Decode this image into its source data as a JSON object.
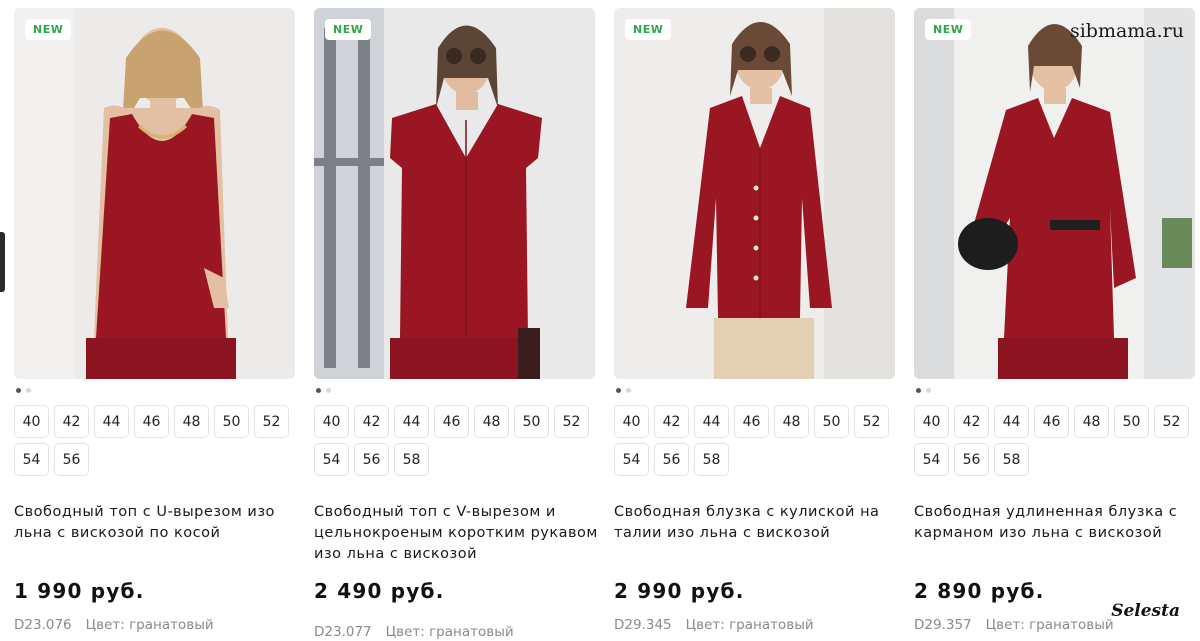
{
  "badge_label": "NEW",
  "watermarks": {
    "top": "sibmama.ru",
    "bottom": "Selesta"
  },
  "products": [
    {
      "badge": "NEW",
      "title": "Свободный топ с U-вырезом изо льна с вискозой по косой",
      "price": "1 990 руб.",
      "code": "D23.076",
      "color": "Цвет: гранатовый",
      "sizes_row1": [
        "40",
        "42",
        "44",
        "46",
        "48",
        "50",
        "52"
      ],
      "sizes_row2": [
        "54",
        "56"
      ],
      "garment": "u-neck-tank-top"
    },
    {
      "badge": "NEW",
      "title": "Свободный топ с V-вырезом и цельнокроеным коротким рукавом изо льна с вискозой",
      "price": "2 490 руб.",
      "code": "D23.077",
      "color": "Цвет: гранатовый",
      "sizes_row1": [
        "40",
        "42",
        "44",
        "46",
        "48",
        "50",
        "52"
      ],
      "sizes_row2": [
        "54",
        "56",
        "58"
      ],
      "garment": "v-neck-top"
    },
    {
      "badge": "NEW",
      "title": "Свободная блузка с кулиской на талии изо льна с вискозой",
      "price": "2 990 руб.",
      "code": "D29.345",
      "color": "Цвет: гранатовый",
      "sizes_row1": [
        "40",
        "42",
        "44",
        "46",
        "48",
        "50",
        "52"
      ],
      "sizes_row2": [
        "54",
        "56",
        "58"
      ],
      "garment": "drawstring-blouse"
    },
    {
      "badge": "NEW",
      "title": "Свободная удлиненная блузка с карманом изо льна с вискозой",
      "price": "2 890 руб.",
      "code": "D29.357",
      "color": "Цвет: гранатовый",
      "sizes_row1": [
        "40",
        "42",
        "44",
        "46",
        "48",
        "50",
        "52"
      ],
      "sizes_row2": [
        "54",
        "56",
        "58"
      ],
      "garment": "long-pocket-blouse"
    }
  ],
  "colors": {
    "garnet": "#9a1622",
    "badge_green": "#2ea84a",
    "muted": "#8a8a8a"
  }
}
